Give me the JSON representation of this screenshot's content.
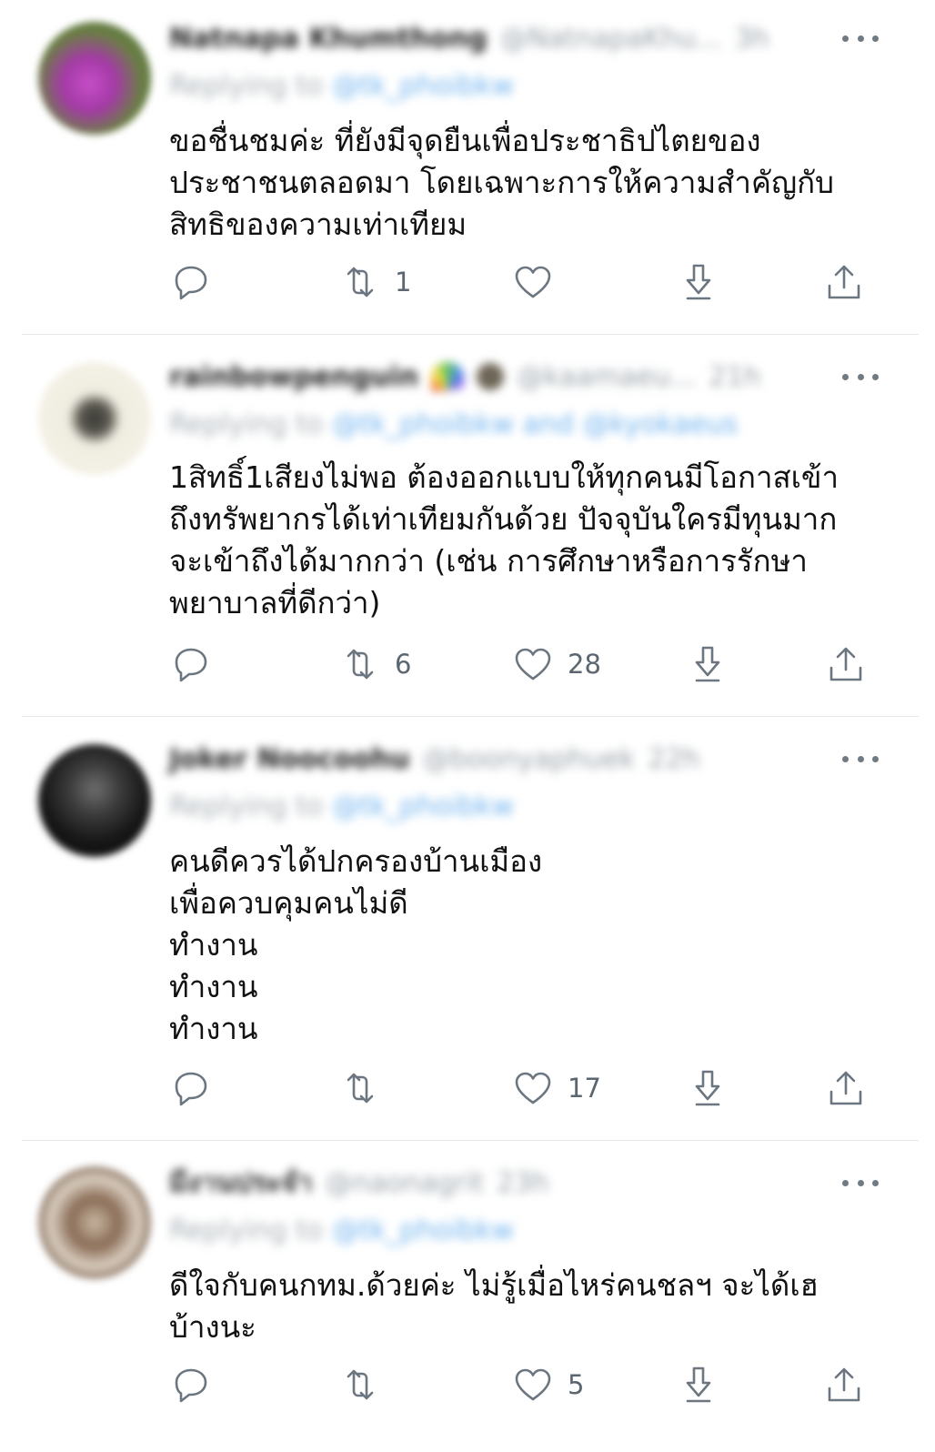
{
  "tweets": [
    {
      "display_name": "Natnapa Khumthong",
      "handle": "@NatnapaKhu...",
      "time": "3h",
      "reply_label": "Replying to",
      "reply_to": "@tk_phoibkw",
      "text_lines": [
        "ขอชื่นชมค่ะ ที่ยังมีจุดยืนเพื่อประชาธิปไตยของ",
        "ประชาชนตลอดมา โดยเฉพาะการให้ความสำคัญกับ",
        "สิทธิของความเท่าเทียม"
      ],
      "reply_count": "",
      "retweet_count": "1",
      "like_count": ""
    },
    {
      "display_name": "rainbowpenguin",
      "handle": "@kaamaeu...",
      "time": "21h",
      "reply_label": "Replying to",
      "reply_to": "@tk_phoibkw and @kyokaeus",
      "text_lines": [
        "1สิทธิ์1เสียงไม่พอ ต้องออกแบบให้ทุกคนมีโอกาสเข้า",
        "ถึงทรัพยากรได้เท่าเทียมกันด้วย ปัจจุบันใครมีทุนมาก",
        "จะเข้าถึงได้มากกว่า (เช่น การศึกษาหรือการรักษา",
        "พยาบาลที่ดีกว่า)"
      ],
      "reply_count": "",
      "retweet_count": "6",
      "like_count": "28"
    },
    {
      "display_name": "Joker Noocoohu",
      "handle": "@boonyaphuek",
      "time": "22h",
      "reply_label": "Replying to",
      "reply_to": "@tk_phoibkw",
      "text_lines": [
        "คนดีควรได้ปกครองบ้านเมือง",
        "เพื่อควบคุมคนไม่ดี",
        "ทำงาน",
        "ทำงาน",
        "ทำงาน"
      ],
      "reply_count": "",
      "retweet_count": "",
      "like_count": "17"
    },
    {
      "display_name": "มีงานประจำ",
      "handle": "@naonagrit",
      "time": "23h",
      "reply_label": "Replying to",
      "reply_to": "@tk_phoibkw",
      "text_lines": [
        "ดีใจกับคนกทม.ด้วยค่ะ ไม่รู้เมื่อไหร่คนชลฯ จะได้เฮ",
        "บ้างนะ"
      ],
      "reply_count": "",
      "retweet_count": "",
      "like_count": "5"
    }
  ]
}
